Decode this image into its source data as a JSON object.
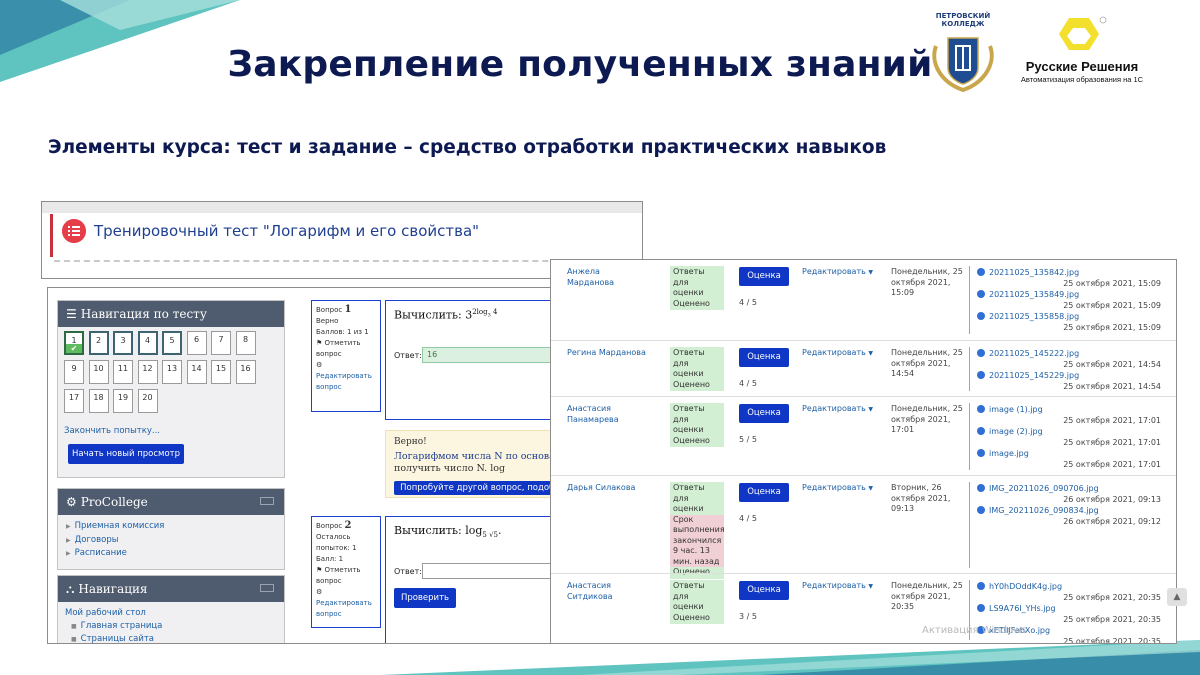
{
  "slide": {
    "title": "Закрепление полученных знаний",
    "subtitle": "Элементы курса: тест и задание – средство отработки практических навыков",
    "college_logo_text": "ПЕТРОВСКИЙ КОЛЛЕДЖ",
    "brand_name": "Русские Решения",
    "brand_tagline": "Автоматизация образования на 1С",
    "activation_watermark": "Активация Windows"
  },
  "colors": {
    "title": "#0d1a52",
    "accent_teal": "#5fc4c0",
    "button_blue": "#0f36c4",
    "link": "#1d5fa6",
    "brand_yellow": "#f2e02c"
  },
  "test_card": {
    "icon": "quiz-list-icon",
    "title": "Тренировочный тест \"Логарифм и его свойства\""
  },
  "quiz_nav": {
    "header": "Навигация по тесту",
    "header_icon": "menu-icon",
    "buttons": [
      "1",
      "2",
      "3",
      "4",
      "5",
      "6",
      "7",
      "8",
      "9",
      "10",
      "11",
      "12",
      "13",
      "14",
      "15",
      "16",
      "17",
      "18",
      "19",
      "20"
    ],
    "finish_link": "Закончить попытку...",
    "new_preview_button": "Начать новый просмотр"
  },
  "procollege_block": {
    "header": "ProCollege",
    "header_icon": "gears-icon",
    "items": [
      "Приемная комиссия",
      "Договоры",
      "Расписание"
    ]
  },
  "navigation_block": {
    "header": "Навигация",
    "header_icon": "sitemap-icon",
    "dashboard": "Мой рабочий стол",
    "items": [
      "Главная страница",
      "Страницы сайта"
    ]
  },
  "question1": {
    "label": "Вопрос",
    "number": "1",
    "status": "Верно",
    "points": "Баллов: 1 из 1",
    "flag": "Отметить вопрос",
    "edit": "Редактировать вопрос",
    "text": "Вычислить: 3",
    "answer_label": "Ответ:",
    "answer_value": "16",
    "feedback_status": "Верно!",
    "feedback_line1": "Логарифмом числа N по основанию",
    "feedback_line2": "получить число N. log",
    "feedback_button": "Попробуйте другой вопрос, подобн"
  },
  "question2": {
    "label": "Вопрос",
    "number": "2",
    "status": "Осталось попыток: 1",
    "points": "Балл: 1",
    "flag": "Отметить вопрос",
    "edit": "Редактировать вопрос",
    "text": "Вычислить: log",
    "answer_label": "Ответ:",
    "check_button": "Проверить"
  },
  "grading": {
    "grade_button": "Оценка",
    "edit_menu": "Редактировать",
    "rows": [
      {
        "name": "Анжела Марданова",
        "status": "Ответы для оценки Оценено",
        "late": "",
        "status_after": "",
        "score": "4 / 5",
        "date": "Понедельник, 25 октября 2021, 15:09",
        "files": [
          {
            "name": "20211025_135842.jpg",
            "date": "25 октября 2021, 15:09"
          },
          {
            "name": "20211025_135849.jpg",
            "date": "25 октября 2021, 15:09"
          },
          {
            "name": "20211025_135858.jpg",
            "date": "25 октября 2021, 15:09"
          }
        ]
      },
      {
        "name": "Регина Марданова",
        "status": "Ответы для оценки Оценено",
        "late": "",
        "status_after": "",
        "score": "4 / 5",
        "date": "Понедельник, 25 октября 2021, 14:54",
        "files": [
          {
            "name": "20211025_145222.jpg",
            "date": "25 октября 2021, 14:54"
          },
          {
            "name": "20211025_145229.jpg",
            "date": "25 октября 2021, 14:54"
          }
        ]
      },
      {
        "name": "Анастасия Панамарева",
        "status": "Ответы для оценки Оценено",
        "late": "",
        "status_after": "",
        "score": "5 / 5",
        "date": "Понедельник, 25 октября 2021, 17:01",
        "files": [
          {
            "name": "image (1).jpg",
            "date": "25 октября 2021, 17:01"
          },
          {
            "name": "image (2).jpg",
            "date": "25 октября 2021, 17:01"
          },
          {
            "name": "image.jpg",
            "date": "25 октября 2021, 17:01"
          }
        ]
      },
      {
        "name": "Дарья Силакова",
        "status": "Ответы для оценки",
        "late": "Срок выполнения закончился 9 час. 13 мин. назад",
        "status_after": "Оценено",
        "score": "4 / 5",
        "date": "Вторник, 26 октября 2021, 09:13",
        "files": [
          {
            "name": "IMG_20211026_090706.jpg",
            "date": "26 октября 2021, 09:13"
          },
          {
            "name": "IMG_20211026_090834.jpg",
            "date": "26 октября 2021, 09:12"
          }
        ]
      },
      {
        "name": "Анастасия Ситдикова",
        "status": "Ответы для оценки Оценено",
        "late": "",
        "status_after": "",
        "score": "3 / 5",
        "date": "Понедельник, 25 октября 2021, 20:35",
        "files": [
          {
            "name": "hY0hDOddK4g.jpg",
            "date": "25 октября 2021, 20:35"
          },
          {
            "name": "LS9A76I_YHs.jpg",
            "date": "25 октября 2021, 20:35"
          },
          {
            "name": "xETIIJFebXo.jpg",
            "date": "25 октября 2021, 20:35"
          }
        ]
      }
    ]
  }
}
